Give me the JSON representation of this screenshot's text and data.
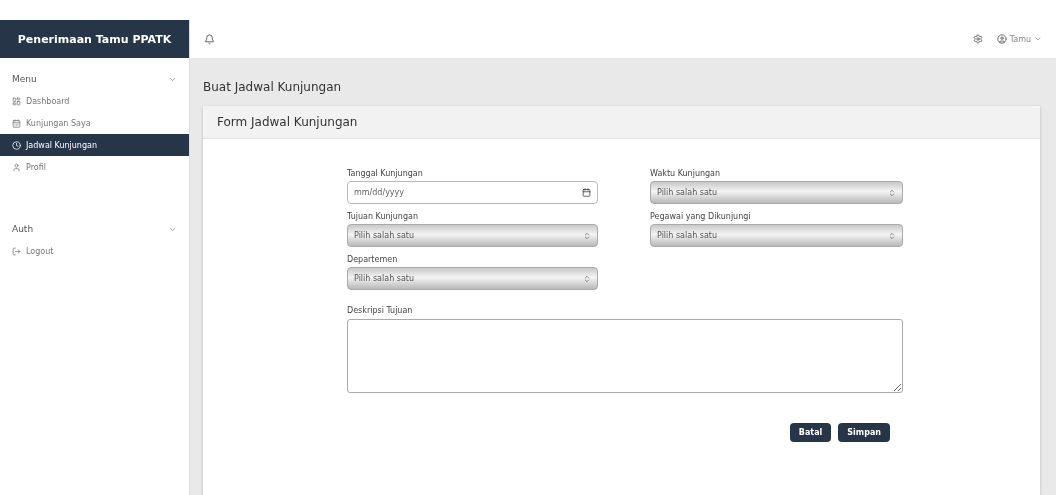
{
  "app": {
    "title": "Penerimaan Tamu PPATK"
  },
  "sidebar": {
    "sections": [
      {
        "label": "Menu",
        "items": [
          {
            "label": "Dashboard",
            "selected": false
          },
          {
            "label": "Kunjungan Saya",
            "selected": false
          },
          {
            "label": "Jadwal Kunjungan",
            "selected": true
          },
          {
            "label": "Profil",
            "selected": false
          }
        ]
      },
      {
        "label": "Auth",
        "items": [
          {
            "label": "Logout",
            "selected": false
          }
        ]
      }
    ]
  },
  "topbar": {
    "user": "Tamu"
  },
  "page_title": "Buat Jadwal Kunjungan",
  "card": {
    "title": "Form Jadwal Kunjungan",
    "fields": [
      {
        "label": "Tanggal Kunjungan",
        "kind": "date",
        "placeholder": "mm/dd/yyyy"
      },
      {
        "label": "Waktu Kunjungan",
        "kind": "select",
        "value": "Pilih salah satu"
      },
      {
        "label": "Tujuan Kunjungan",
        "kind": "select",
        "value": "Pilih salah satu"
      },
      {
        "label": "Pegawai yang Dikunjungi",
        "kind": "select",
        "value": "Pilih salah satu"
      },
      {
        "label": "Departemen",
        "kind": "select",
        "value": "Pilih salah satu"
      }
    ],
    "description": {
      "label": "Deskripsi Tujuan"
    },
    "buttons": [
      "Batal",
      "Simpan"
    ]
  }
}
